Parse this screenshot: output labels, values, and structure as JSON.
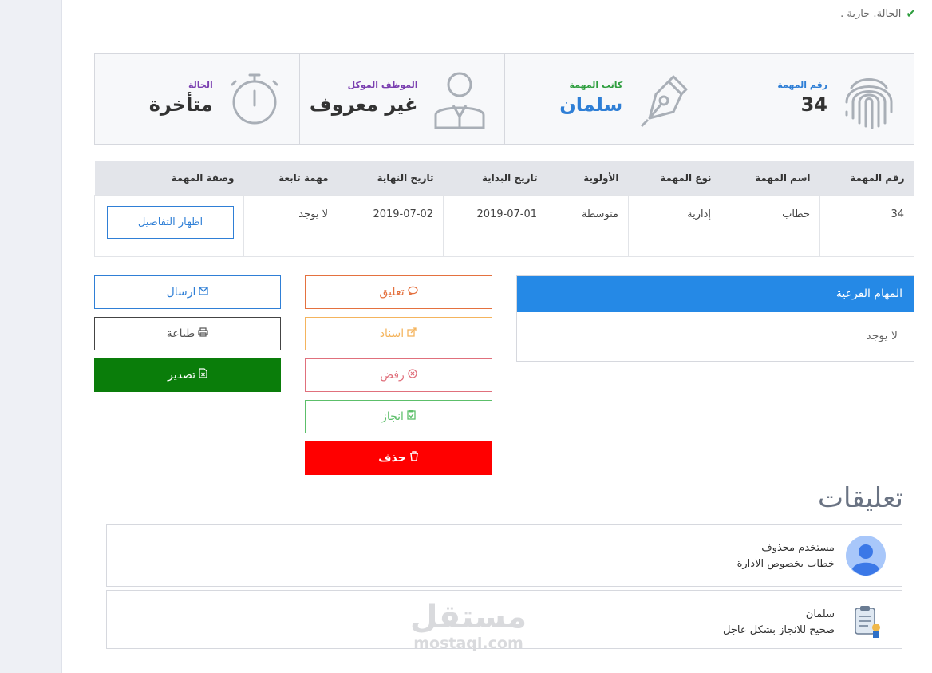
{
  "status_line": "الحالة. جارية .",
  "cards": [
    {
      "label": "رقم المهمة",
      "value": "34",
      "label_color": "#2f7fd6",
      "value_color": "#333333",
      "icon": "fingerprint-icon"
    },
    {
      "label": "كاتب المهمة",
      "value": "سلمان",
      "label_color": "#2e9e3e",
      "value_color": "#2f7fd6",
      "icon": "pen-nib-icon"
    },
    {
      "label": "الموظف الموكل",
      "value": "غير معروف",
      "label_color": "#7a3fb0",
      "value_color": "#333333",
      "icon": "user-icon"
    },
    {
      "label": "الحالة",
      "value": "متأخرة",
      "label_color": "#7a3fb0",
      "value_color": "#333333",
      "icon": "stopwatch-icon"
    }
  ],
  "table": {
    "headers": [
      "رقم المهمة",
      "اسم المهمة",
      "نوع المهمة",
      "الأولوية",
      "تاريخ البداية",
      "تاريخ النهاية",
      "مهمة تابعة",
      "وصفة المهمة"
    ],
    "row": {
      "number": "34",
      "name": "خطاب",
      "type": "إدارية",
      "priority": "متوسطة",
      "start_date": "2019-07-01",
      "end_date": "2019-07-02",
      "parent_task": "لا يوجد",
      "details_button": "اظهار التفاصيل"
    }
  },
  "subtasks": {
    "title": "المهام الفرعية",
    "empty_text": "لا يوجد"
  },
  "actions": {
    "comment": "تعليق",
    "assign": "اسناد",
    "reject": "رفض",
    "complete": "انجاز",
    "delete": "حذف",
    "send": "ارسال",
    "print": "طباعة",
    "export": "تصدير"
  },
  "comments": {
    "title": "تعليقات",
    "items": [
      {
        "author": "مستخدم محذوف",
        "text": "خطاب بخصوص الادارة",
        "avatar": "default-avatar-icon"
      },
      {
        "author": "سلمان",
        "text": "صحيح للانجاز بشكل عاجل",
        "avatar": "clipboard-avatar-icon"
      }
    ]
  },
  "watermark": {
    "arabic": "مستقل",
    "latin": "mostaql.com"
  }
}
